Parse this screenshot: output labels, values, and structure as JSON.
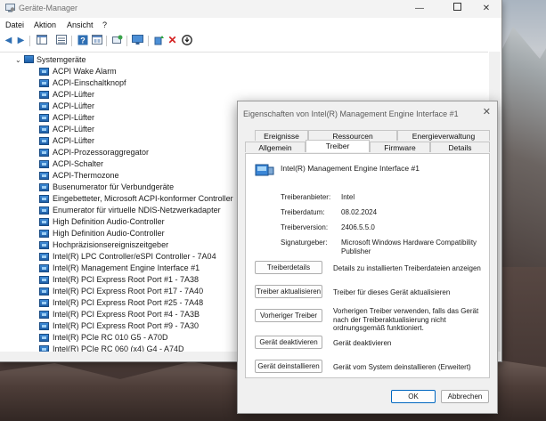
{
  "window": {
    "title": "Geräte-Manager",
    "controls": {
      "minimize": "—",
      "close": "✕"
    }
  },
  "menu": [
    "Datei",
    "Aktion",
    "Ansicht",
    "?"
  ],
  "tree": {
    "root": "Systemgeräte",
    "items": [
      "ACPI Wake Alarm",
      "ACPI-Einschaltknopf",
      "ACPI-Lüfter",
      "ACPI-Lüfter",
      "ACPI-Lüfter",
      "ACPI-Lüfter",
      "ACPI-Lüfter",
      "ACPI-Prozessoraggregator",
      "ACPI-Schalter",
      "ACPI-Thermozone",
      "Busenumerator für Verbundgeräte",
      "Eingebetteter, Microsoft ACPI-konformer Controller",
      "Enumerator für virtuelle NDIS-Netzwerkadapter",
      "High Definition Audio-Controller",
      "High Definition Audio-Controller",
      "Hochpräzisionsereigniszeitgeber",
      "Intel(R) LPC Controller/eSPI Controller - 7A04",
      "Intel(R) Management Engine Interface #1",
      "Intel(R) PCI Express Root Port #1 - 7A38",
      "Intel(R) PCI Express Root Port #17 - 7A40",
      "Intel(R) PCI Express Root Port #25 - 7A48",
      "Intel(R) PCI Express Root Port #4 - 7A3B",
      "Intel(R) PCI Express Root Port #9 - 7A30",
      "Intel(R) PCIe RC 010 G5 - A70D",
      "Intel(R) PCIe RC 060 (x4) G4 - A74D"
    ]
  },
  "dialog": {
    "title": "Eigenschaften von Intel(R) Management Engine Interface #1",
    "close": "✕",
    "tabs_row1": [
      "Ereignisse",
      "Ressourcen",
      "Energieverwaltung"
    ],
    "tabs_row2": [
      "Allgemein",
      "Treiber",
      "Firmware",
      "Details"
    ],
    "device_name": "Intel(R) Management Engine Interface #1",
    "fields": [
      {
        "label": "Treiberanbieter:",
        "value": "Intel"
      },
      {
        "label": "Treiberdatum:",
        "value": "08.02.2024"
      },
      {
        "label": "Treiberversion:",
        "value": "2406.5.5.0"
      },
      {
        "label": "Signaturgeber:",
        "value": "Microsoft Windows Hardware Compatibility Publisher"
      }
    ],
    "actions": [
      {
        "button": "Treiberdetails",
        "desc": "Details zu installierten Treiberdateien anzeigen"
      },
      {
        "button": "Treiber aktualisieren",
        "desc": "Treiber für dieses Gerät aktualisieren"
      },
      {
        "button": "Vorheriger Treiber",
        "desc": "Vorherigen Treiber verwenden, falls das Gerät nach der Treiberaktualisierung nicht ordnungsgemäß funktioniert."
      },
      {
        "button": "Gerät deaktivieren",
        "desc": "Gerät deaktivieren"
      },
      {
        "button": "Gerät deinstallieren",
        "desc": "Gerät vom System deinstallieren (Erweitert)"
      }
    ],
    "ok": "OK",
    "cancel": "Abbrechen"
  }
}
